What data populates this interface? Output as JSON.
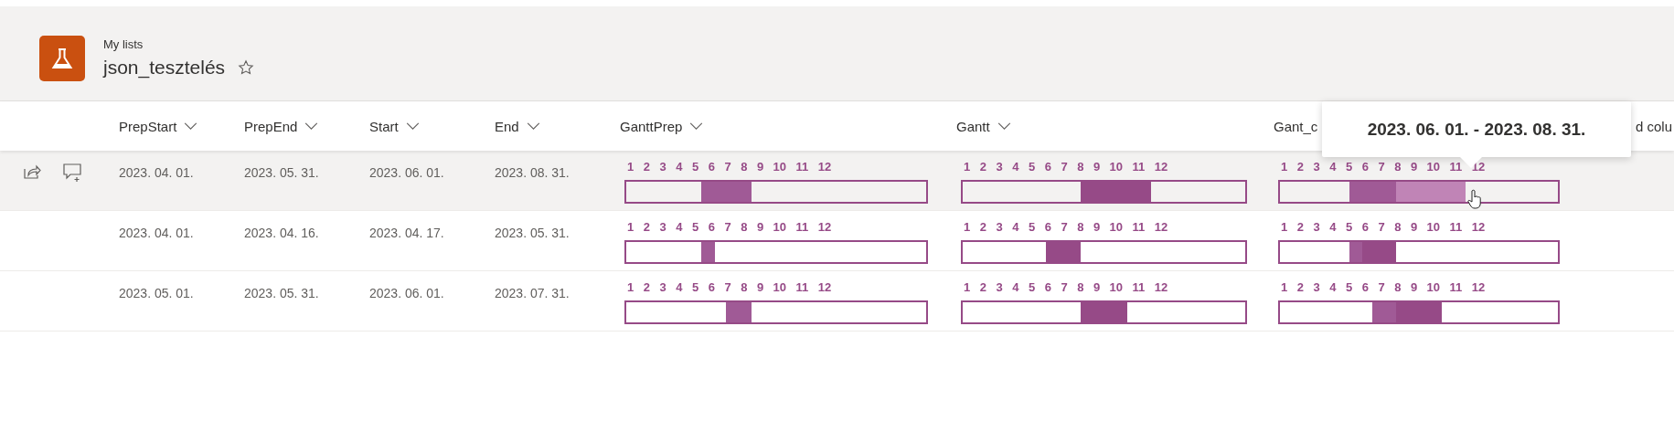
{
  "header": {
    "breadcrumb": "My lists",
    "title": "json_tesztelés",
    "favorite": false
  },
  "columns": [
    {
      "label": "PrepStart",
      "kind": "date"
    },
    {
      "label": "PrepEnd",
      "kind": "date"
    },
    {
      "label": "Start",
      "kind": "date"
    },
    {
      "label": "End",
      "kind": "date"
    },
    {
      "label": "GanttPrep",
      "kind": "gantt"
    },
    {
      "label": "Gantt",
      "kind": "gantt"
    },
    {
      "label": "Gant_c",
      "kind": "wide"
    },
    {
      "label": "d colu",
      "kind": "partial"
    }
  ],
  "rows": [
    {
      "hovered": true,
      "prep_start": "2023. 04. 01.",
      "prep_end": "2023. 05. 31.",
      "start": "2023. 06. 01.",
      "end": "2023. 08. 31.",
      "gantts": [
        {
          "kind": "prep",
          "months": [
            "1",
            "2",
            "3",
            "4",
            "5",
            "6",
            "7",
            "8",
            "9",
            "10",
            "11",
            "12"
          ]
        },
        {
          "kind": "main",
          "months": [
            "1",
            "2",
            "3",
            "4",
            "5",
            "6",
            "7",
            "8",
            "9",
            "10",
            "11",
            "12"
          ]
        },
        {
          "kind": "combined",
          "months": [
            "1",
            "2",
            "3",
            "4",
            "5",
            "6",
            "7",
            "8",
            "9",
            "10",
            "11",
            "12"
          ]
        }
      ]
    },
    {
      "hovered": false,
      "prep_start": "2023. 04. 01.",
      "prep_end": "2023. 04. 16.",
      "start": "2023. 04. 17.",
      "end": "2023. 05. 31.",
      "gantts": [
        {
          "kind": "prep",
          "months": [
            "1",
            "2",
            "3",
            "4",
            "5",
            "6",
            "7",
            "8",
            "9",
            "10",
            "11",
            "12"
          ]
        },
        {
          "kind": "main",
          "months": [
            "1",
            "2",
            "3",
            "4",
            "5",
            "6",
            "7",
            "8",
            "9",
            "10",
            "11",
            "12"
          ]
        },
        {
          "kind": "combined",
          "months": [
            "1",
            "2",
            "3",
            "4",
            "5",
            "6",
            "7",
            "8",
            "9",
            "10",
            "11",
            "12"
          ]
        }
      ]
    },
    {
      "hovered": false,
      "prep_start": "2023. 05. 01.",
      "prep_end": "2023. 05. 31.",
      "start": "2023. 06. 01.",
      "end": "2023. 07. 31.",
      "gantts": [
        {
          "kind": "prep",
          "months": [
            "1",
            "2",
            "3",
            "4",
            "5",
            "6",
            "7",
            "8",
            "9",
            "10",
            "11",
            "12"
          ]
        },
        {
          "kind": "main",
          "months": [
            "1",
            "2",
            "3",
            "4",
            "5",
            "6",
            "7",
            "8",
            "9",
            "10",
            "11",
            "12"
          ]
        },
        {
          "kind": "combined",
          "months": [
            "1",
            "2",
            "3",
            "4",
            "5",
            "6",
            "7",
            "8",
            "9",
            "10",
            "11",
            "12"
          ]
        }
      ]
    }
  ],
  "tooltip": {
    "text": "2023. 06. 01. - 2023. 08. 31."
  }
}
